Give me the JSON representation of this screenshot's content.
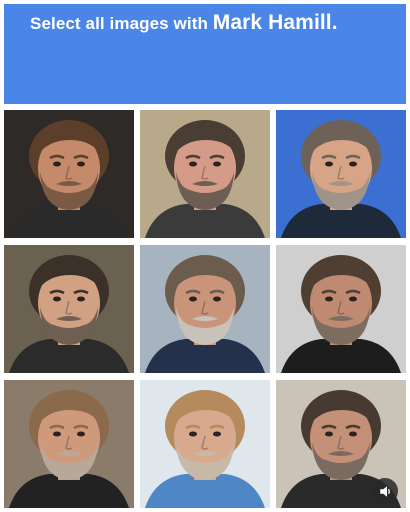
{
  "header": {
    "prompt_prefix": "Select all images with",
    "prompt_subject": "Mark Hamill.",
    "bg_color": "#4a86e8"
  },
  "grid": {
    "rows": 3,
    "cols": 3,
    "tiles": [
      {
        "name": "tile-1-1",
        "background": "#2e2a27",
        "skin": "#c48a6a",
        "hair": "#5b3f2a",
        "beard": "#7a5a44",
        "shirt": "#2a2a2a"
      },
      {
        "name": "tile-1-2",
        "background": "#b8a98a",
        "skin": "#d49c88",
        "hair": "#4a3d33",
        "beard": "#6e5d52",
        "shirt": "#3b3b3b"
      },
      {
        "name": "tile-1-3",
        "background": "#3b6fd1",
        "skin": "#d7a488",
        "hair": "#6e6258",
        "beard": "#a09488",
        "shirt": "#1e2a3a"
      },
      {
        "name": "tile-2-1",
        "background": "#6a6150",
        "skin": "#d2a083",
        "hair": "#3b3128",
        "beard": "#6e5f52",
        "shirt": "#2b2b2b"
      },
      {
        "name": "tile-2-2",
        "background": "#a7b3bf",
        "skin": "#c99479",
        "hair": "#6b5c4d",
        "beard": "#c9c2b8",
        "shirt": "#23324a"
      },
      {
        "name": "tile-2-3",
        "background": "#cfcfcf",
        "skin": "#c08a72",
        "hair": "#4f3f33",
        "beard": "#7d6d60",
        "shirt": "#1d1d1d"
      },
      {
        "name": "tile-3-1",
        "background": "#8a7b6a",
        "skin": "#cf9a7c",
        "hair": "#8a6a4a",
        "beard": "#b8a898",
        "shirt": "#222222"
      },
      {
        "name": "tile-3-2",
        "background": "#dfe6ec",
        "skin": "#d8a98c",
        "hair": "#b58a5c",
        "beard": "#c8b8a8",
        "shirt": "#4f86c6"
      },
      {
        "name": "tile-3-3",
        "background": "#c9c3b8",
        "skin": "#c59078",
        "hair": "#463a31",
        "beard": "#7a6b60",
        "shirt": "#2a2a2a"
      }
    ]
  },
  "audio_button": {
    "icon": "speaker-icon"
  }
}
